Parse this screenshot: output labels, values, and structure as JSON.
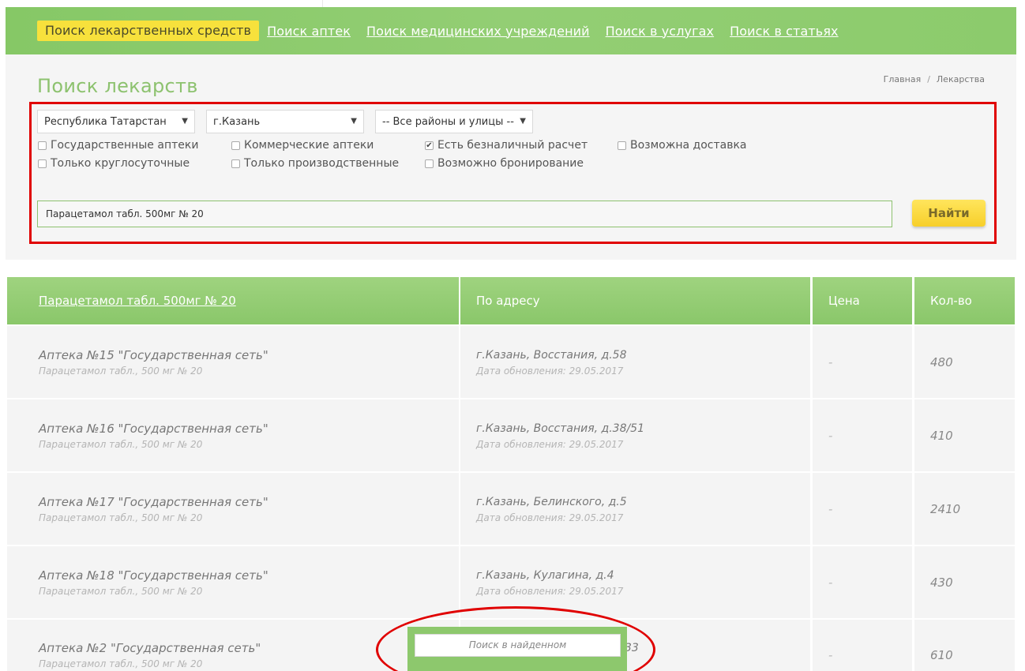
{
  "nav": {
    "items": [
      {
        "label": "Поиск лекарственных средств",
        "active": true
      },
      {
        "label": "Поиск аптек",
        "active": false
      },
      {
        "label": "Поиск медицинских учреждений",
        "active": false
      },
      {
        "label": "Поиск в услугах",
        "active": false
      },
      {
        "label": "Поиск в статьях",
        "active": false
      }
    ]
  },
  "page": {
    "title": "Поиск лекарств",
    "breadcrumb": [
      "Главная",
      "Лекарства"
    ],
    "breadcrumb_sep": "/"
  },
  "filters": {
    "region": "Республика Татарстан",
    "city": "г.Казань",
    "district": "-- Все районы и улицы --",
    "checkboxes": [
      {
        "label": "Государственные аптеки",
        "checked": false
      },
      {
        "label": "Коммерческие аптеки",
        "checked": false
      },
      {
        "label": "Есть безналичный расчет",
        "checked": true
      },
      {
        "label": "Возможна доставка",
        "checked": false
      },
      {
        "label": "Только круглосуточные",
        "checked": false
      },
      {
        "label": "Только производственные",
        "checked": false
      },
      {
        "label": "Возможно бронирование",
        "checked": false
      }
    ],
    "query": "Парацетамол табл. 500мг № 20",
    "find_label": "Найти"
  },
  "table": {
    "headers": {
      "drug": "Парацетамол табл. 500мг № 20",
      "address": "По адресу",
      "price": "Цена",
      "qty": "Кол-во"
    },
    "rows": [
      {
        "pharmacy": "Аптека №15 \"Государственная сеть\"",
        "drug": "Парацетамол табл., 500 мг № 20",
        "address": "г.Казань, Восстания, д.58",
        "updated": "Дата обновления: 29.05.2017",
        "price": "-",
        "qty": "480"
      },
      {
        "pharmacy": "Аптека №16 \"Государственная сеть\"",
        "drug": "Парацетамол табл., 500 мг № 20",
        "address": "г.Казань, Восстания, д.38/51",
        "updated": "Дата обновления: 29.05.2017",
        "price": "-",
        "qty": "410"
      },
      {
        "pharmacy": "Аптека №17 \"Государственная сеть\"",
        "drug": "Парацетамол табл., 500 мг № 20",
        "address": "г.Казань, Белинского, д.5",
        "updated": "Дата обновления: 29.05.2017",
        "price": "-",
        "qty": "2410"
      },
      {
        "pharmacy": "Аптека №18 \"Государственная сеть\"",
        "drug": "Парацетамол табл., 500 мг № 20",
        "address": "г.Казань, Кулагина, д.4",
        "updated": "Дата обновления: 29.05.2017",
        "price": "-",
        "qty": "430"
      },
      {
        "pharmacy": "Аптека №2 \"Государственная сеть\"",
        "drug": "Парацетамол табл., 500 мг № 20",
        "address_partial": "33",
        "price": "-",
        "qty": "610"
      }
    ]
  },
  "inner_search": {
    "placeholder": "Поиск в найденном"
  },
  "colors": {
    "accent_green": "#8dc26f",
    "active_tab_yellow": "#f7e13c",
    "highlight_red": "#e00000",
    "button_yellow": "#f7cf2a"
  }
}
